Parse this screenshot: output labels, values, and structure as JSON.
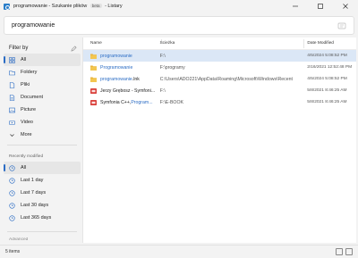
{
  "window": {
    "title_prefix": "programowanie - Szukanie plików",
    "title_badge": "beta",
    "title_suffix": "- Listary",
    "controls": [
      "—",
      "☐",
      "✕"
    ]
  },
  "search": {
    "query": "programowanie"
  },
  "sidebar": {
    "filter_label": "Filter by",
    "items": [
      {
        "label": "All",
        "icon": "grid-icon",
        "active": true
      },
      {
        "label": "Foldery",
        "icon": "folder-icon"
      },
      {
        "label": "Pliki",
        "icon": "file-icon"
      },
      {
        "label": "Document",
        "icon": "document-icon"
      },
      {
        "label": "Picture",
        "icon": "picture-icon"
      },
      {
        "label": "Video",
        "icon": "video-icon"
      },
      {
        "label": "More",
        "icon": "chevron-down-icon"
      }
    ],
    "recent_title": "Recently modified",
    "recent_items": [
      {
        "label": "All",
        "active": true
      },
      {
        "label": "Last 1 day"
      },
      {
        "label": "Last 7 days"
      },
      {
        "label": "Last 30 days"
      },
      {
        "label": "Last 365 days"
      }
    ],
    "advanced_label": "Advanced"
  },
  "list": {
    "headers": {
      "name": "Name",
      "path": "Ścieżka",
      "date": "Date Modified"
    },
    "rows": [
      {
        "name_hl": "programowanie",
        "name_rest": "",
        "path": "F:\\",
        "date": "4/5/2024 5:08:52 PM",
        "icon": "folder",
        "selected": true
      },
      {
        "name_hl": "Programowanie",
        "name_rest": "",
        "path": "F:\\programy",
        "date": "2/16/2021 12:52:48 PM",
        "icon": "folder"
      },
      {
        "name_hl": "programowanie",
        "name_rest": ".lnk",
        "path": "C:\\Users\\ADO221\\AppData\\Roaming\\Microsoft\\Windows\\Recent",
        "date": "4/5/2024 5:08:52 PM",
        "icon": "folder"
      },
      {
        "name_hl": "",
        "name_rest": "Jerzy Grębosz - Symfoni...",
        "path": "F:\\",
        "date": "5/8/2021 8:46:25 AM",
        "icon": "pdf"
      },
      {
        "name_hl_prefix": "Symfonia C++, ",
        "name_hl": "Program...",
        "name_rest": "",
        "path": "F:\\E-BOOK",
        "date": "5/8/2021 8:46:25 AM",
        "icon": "pdf"
      }
    ]
  },
  "status": {
    "count": "5 items"
  },
  "colors": {
    "accent": "#2b6cc4",
    "selection": "#dbe7f6",
    "folder": "#e8b33a",
    "pdf": "#d9403a"
  }
}
